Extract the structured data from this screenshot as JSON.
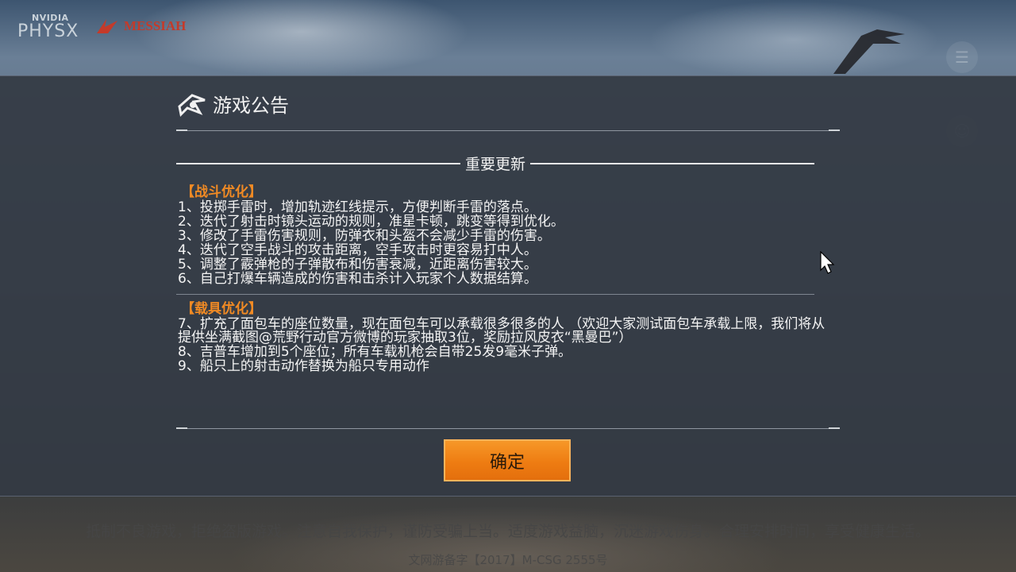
{
  "brand": {
    "nvidia_small": "NVIDIA",
    "nvidia_big": "PHYSX",
    "messiah": "MESSIAH"
  },
  "dialog": {
    "title": "游戏公告",
    "subtitle": "重要更新",
    "sections": [
      {
        "title": "【战斗优化】",
        "items": [
          "1、投掷手雷时，增加轨迹红线提示，方便判断手雷的落点。",
          "2、迭代了射击时镜头运动的规则，准星卡顿，跳变等得到优化。",
          "3、修改了手雷伤害规则，防弹衣和头盔不会减少手雷的伤害。",
          "4、迭代了空手战斗的攻击距离，空手攻击时更容易打中人。",
          "5、调整了霰弹枪的子弹散布和伤害衰减，近距离伤害较大。",
          "6、自己打爆车辆造成的伤害和击杀计入玩家个人数据结算。"
        ]
      },
      {
        "title": "【载具优化】",
        "items": [
          "7、扩充了面包车的座位数量，现在面包车可以承载很多很多的人 （欢迎大家测试面包车承载上限，我们将从提供坐满截图@荒野行动官方微博的玩家抽取3位，奖励拉风皮衣“黑曼巴”）",
          "8、吉普车增加到5个座位；所有车载机枪会自带25发9毫米子弹。",
          "9、船只上的射击动作替换为船只专用动作"
        ]
      }
    ],
    "confirm_label": "确定"
  },
  "footer": {
    "notice": "抵制不良游戏，拒绝盗版游戏。注意自我保护，谨防受骗上当。适度游戏益脑，沉迷游戏伤身。合理安排时间，享受健康生活。",
    "license": "文网游备字【2017】M-CSG 2555号"
  },
  "colors": {
    "accent": "#f08a24",
    "button": "#ee7c12",
    "overlay": "#343a44"
  },
  "icons": [
    "game-logo-icon",
    "document-icon",
    "chat-icon",
    "mouse-cursor-icon",
    "airplane-icon"
  ]
}
